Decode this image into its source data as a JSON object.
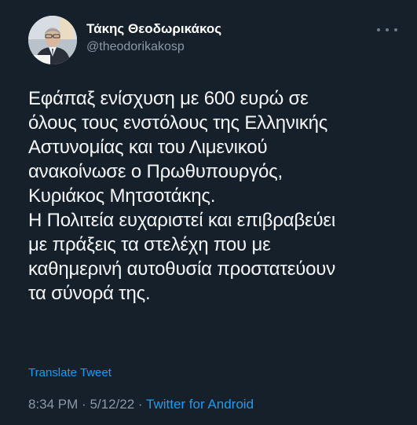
{
  "tweet": {
    "author": {
      "name": "Τάκης Θεοδωρικάκος",
      "handle": "@theodorikakosp"
    },
    "text": "Εφάπαξ ενίσχυση με 600 ευρώ σε\nόλους τους ενστόλους της Ελληνικής\nΑστυνομίας και του Λιμενικού\nανακοίνωσε ο Πρωθυπουργός,\nΚυριάκος Μητσοτάκης.\nΗ Πολιτεία ευχαριστεί και επιβραβεύει\nμε πράξεις τα στελέχη που με\nκαθημερινή αυτοθυσία προστατεύουν\nτα σύνορά της.",
    "translate_label": "Translate Tweet",
    "time": "8:34 PM",
    "date": "5/12/22",
    "separator": "·",
    "source": "Twitter for Android"
  },
  "icons": {
    "more": "more-horizontal-icon",
    "avatar": "profile-photo"
  },
  "colors": {
    "background": "#15202b",
    "text": "#ffffff",
    "secondary_text": "#8b98a5",
    "link": "#1d9bf0"
  }
}
